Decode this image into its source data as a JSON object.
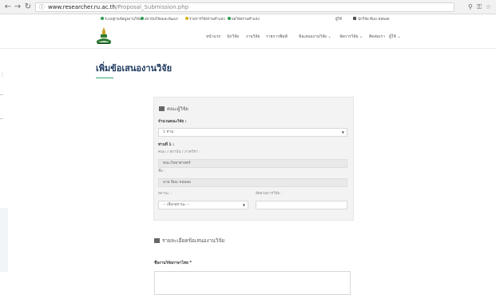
{
  "browser": {
    "url_host": "www.researcher.ru.ac.th",
    "url_path": "/Proposal_Submission.php",
    "back_icon": "arrow-left",
    "forward_icon": "arrow-right",
    "reload_icon": "reload",
    "info_icon": "info-circle",
    "zoom_icon": "magnifier",
    "key_icon": "key",
    "star_icon": "star"
  },
  "topbar": {
    "links": [
      {
        "label": "ระบบฐานข้อมูลงานวิจัย",
        "color": "#2e9c4f"
      },
      {
        "label": "สถาบันวิจัยและพัฒนา",
        "color": "#2e9c4f"
      },
      {
        "label": "รายการวิจัยรามคำแหง",
        "color": "#d8b41c"
      },
      {
        "label": "ผลวิจัยรามคำแหง",
        "color": "#2e9c4f"
      }
    ],
    "login_hint": "ผู้ใช้",
    "user": "นักวิจัย ทีมม หอพลอ"
  },
  "header": {
    "logo": "ru-emblem",
    "menu": [
      {
        "label": "หน้าแรก",
        "dropdown": false
      },
      {
        "label": "นักวิจัย",
        "dropdown": false
      },
      {
        "label": "งานวิจัย",
        "dropdown": false
      },
      {
        "label": "รายการพิมพ์",
        "dropdown": false
      },
      {
        "label": "ข้อเสนองานวิจัย",
        "dropdown": true
      },
      {
        "label": "จัดการวิจัย",
        "dropdown": true
      },
      {
        "label": "ติดต่อเรา",
        "dropdown": false
      },
      {
        "label": "ผู้ใช้",
        "dropdown": true
      }
    ]
  },
  "page": {
    "title": "เพิ่มข้อเสนองานวิจัย"
  },
  "form": {
    "team_section_title": "คณะผู้วิจัย",
    "researcher_count_label": "จำนวนคณะวิจัย :",
    "researcher_count_value": "1 ท่าน",
    "person_label": "ท่านที่ 1 :",
    "faculty_label": "คณะ / สถาบัน / ภาควิชา :",
    "faculty_value": "คณะวิทยาศาสตร์",
    "name_label": "ชื่อ :",
    "name_value": "นาย ทีมม หอพลอ",
    "status_label": "สถานะ :",
    "status_placeholder": "-- เลือกสถานะ --",
    "share_label": "สัดส่วนการวิจัย :",
    "share_value": "",
    "detail_section_title": "รายละเอียดข้อเสนองานวิจัย",
    "thai_name_label": "ชื่องานวิจัยภาษาไทย *",
    "thai_name_value": ""
  }
}
